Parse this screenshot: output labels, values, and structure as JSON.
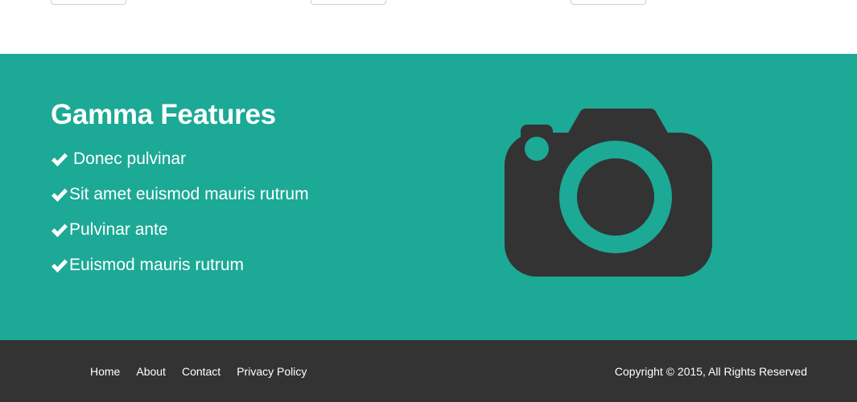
{
  "features": {
    "title": "Gamma Features",
    "items": [
      {
        "label": "Donec pulvinar"
      },
      {
        "label": "Sit amet euismod mauris rutrum"
      },
      {
        "label": "Pulvinar ante"
      },
      {
        "label": "Euismod mauris rutrum"
      }
    ],
    "item_icon": "check-icon",
    "illustration_icon": "camera-icon",
    "background_color": "#1ca996",
    "icon_color": "#333333"
  },
  "footer": {
    "links": [
      {
        "label": "Home"
      },
      {
        "label": "About"
      },
      {
        "label": "Contact"
      },
      {
        "label": "Privacy Policy"
      }
    ],
    "copyright": "Copyright © 2015, All Rights Reserved",
    "background_color": "#333333"
  }
}
